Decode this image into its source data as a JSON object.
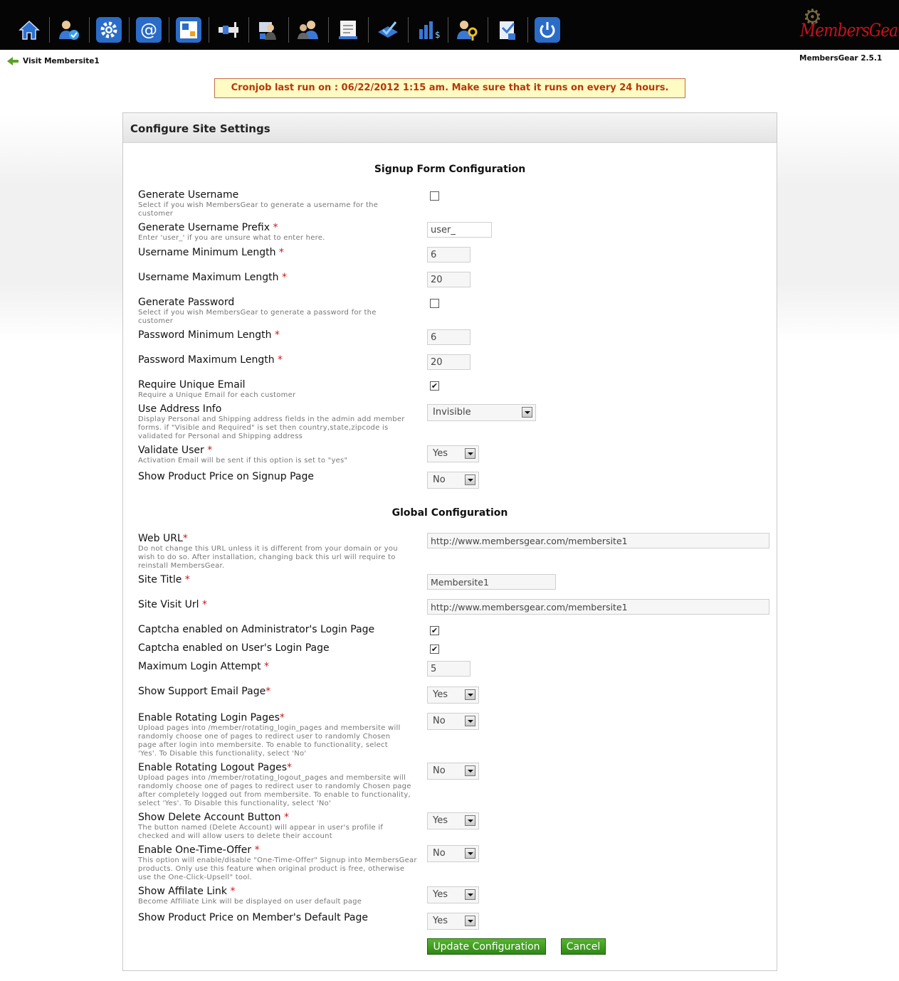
{
  "top_nav": {
    "icons": [
      {
        "name": "home-icon",
        "color": "#2b6fd1"
      },
      {
        "name": "members-icon",
        "color": "#3a78d4"
      },
      {
        "name": "settings-gear-icon",
        "color": "#2a6cc8"
      },
      {
        "name": "email-icon",
        "color": "#2a6cc8"
      },
      {
        "name": "pages-icon",
        "color": "#2a6cc8"
      },
      {
        "name": "products-icon",
        "color": "#3a78d4"
      },
      {
        "name": "affiliates-icon",
        "color": "#3a78d4"
      },
      {
        "name": "users-icon",
        "color": "#3a78d4"
      },
      {
        "name": "content-icon",
        "color": "#3a78d4"
      },
      {
        "name": "payments-icon",
        "color": "#3a78d4"
      },
      {
        "name": "reports-icon",
        "color": "#3a78d4"
      },
      {
        "name": "admin-key-icon",
        "color": "#3a78d4"
      },
      {
        "name": "tools-icon",
        "color": "#3a78d4"
      },
      {
        "name": "logout-power-icon",
        "color": "#2a6cc8"
      }
    ],
    "logo_text": "MembersGear"
  },
  "header": {
    "visit_link": "Visit Membersite1",
    "version": "MembersGear 2.5.1"
  },
  "cron_notice": "Cronjob last run on : 06/22/2012 1:15 am. Make sure that it runs on every 24 hours.",
  "panel": {
    "title": "Configure Site Settings",
    "signup_section": "Signup Form Configuration",
    "global_section": "Global Configuration"
  },
  "fields": {
    "gen_username": {
      "label": "Generate Username",
      "desc": "Select if you wish MembersGear to generate a username for the customer",
      "checked": false
    },
    "gen_username_prefix": {
      "label": "Generate Username Prefix",
      "desc": "Enter 'user_' if you are unsure what to enter here.",
      "value": "user_"
    },
    "username_min": {
      "label": "Username Minimum Length",
      "value": "6"
    },
    "username_max": {
      "label": "Username Maximum Length",
      "value": "20"
    },
    "gen_password": {
      "label": "Generate Password",
      "desc": "Select if you wish MembersGear to generate a password for the customer",
      "checked": false
    },
    "password_min": {
      "label": "Password Minimum Length",
      "value": "6"
    },
    "password_max": {
      "label": "Password Maximum Length",
      "value": "20"
    },
    "unique_email": {
      "label": "Require Unique Email",
      "desc": "Require a Unique Email for each customer",
      "checked": true
    },
    "address_info": {
      "label": "Use Address Info",
      "desc": "Display Personal and Shipping address fields in the admin add member forms. if \"Visible and Required\" is set then country,state,zipcode is validated for Personal and Shipping address",
      "value": "Invisible"
    },
    "validate_user": {
      "label": "Validate User",
      "desc": "Activation Email will be sent if this option is set to \"yes\"",
      "value": "Yes"
    },
    "show_price_signup": {
      "label": "Show Product Price on Signup Page",
      "value": "No"
    },
    "web_url": {
      "label": "Web URL",
      "desc": "Do not change this URL unless it is different from your domain or you wish to do so. After installation, changing back this url will require to reinstall MembersGear.",
      "value": "http://www.membersgear.com/membersite1"
    },
    "site_title": {
      "label": "Site Title",
      "value": "Membersite1"
    },
    "site_visit_url": {
      "label": "Site Visit Url",
      "value": "http://www.membersgear.com/membersite1"
    },
    "captcha_admin": {
      "label": "Captcha enabled on Administrator's Login Page",
      "checked": true
    },
    "captcha_user": {
      "label": "Captcha enabled on User's Login Page",
      "checked": true
    },
    "max_login": {
      "label": "Maximum Login Attempt",
      "value": "5"
    },
    "support_email": {
      "label": "Show Support Email Page",
      "value": "Yes"
    },
    "rotating_login": {
      "label": "Enable Rotating Login Pages",
      "desc": "Upload pages into /member/rotating_login_pages and membersite will randomly choose one of pages to redirect user to randomly Chosen page after login into membersite. To enable to functionality, select 'Yes'. To Disable this functionality, select 'No'",
      "value": "No"
    },
    "rotating_logout": {
      "label": "Enable Rotating Logout Pages",
      "desc": "Upload pages into /member/rotating_logout_pages and membersite will randomly choose one of pages to redirect user to randomly Chosen page after completely logged out from membersite. To enable to functionality, select 'Yes'. To Disable this functionality, select 'No'",
      "value": "No"
    },
    "delete_account": {
      "label": "Show Delete Account Button",
      "desc": "The button named (Delete Account) will appear in user's profile if checked and will allow users to delete their account",
      "value": "Yes"
    },
    "one_time_offer": {
      "label": "Enable One-Time-Offer",
      "desc": "This option will enable/disable \"One-Time-Offer\" Signup into MembersGear products. Only use this feature when original product is free, otherwise use the One-Click-Upsell\" tool.",
      "value": "No"
    },
    "affiliate_link": {
      "label": "Show Affilate Link",
      "desc": "Become Affiliate Link will be displayed on user default page",
      "value": "Yes"
    },
    "show_price_default": {
      "label": "Show Product Price on Member's Default Page",
      "value": "Yes"
    }
  },
  "required_marker": "*",
  "check_glyph": "✔",
  "buttons": {
    "update": "Update Configuration",
    "cancel": "Cancel"
  }
}
